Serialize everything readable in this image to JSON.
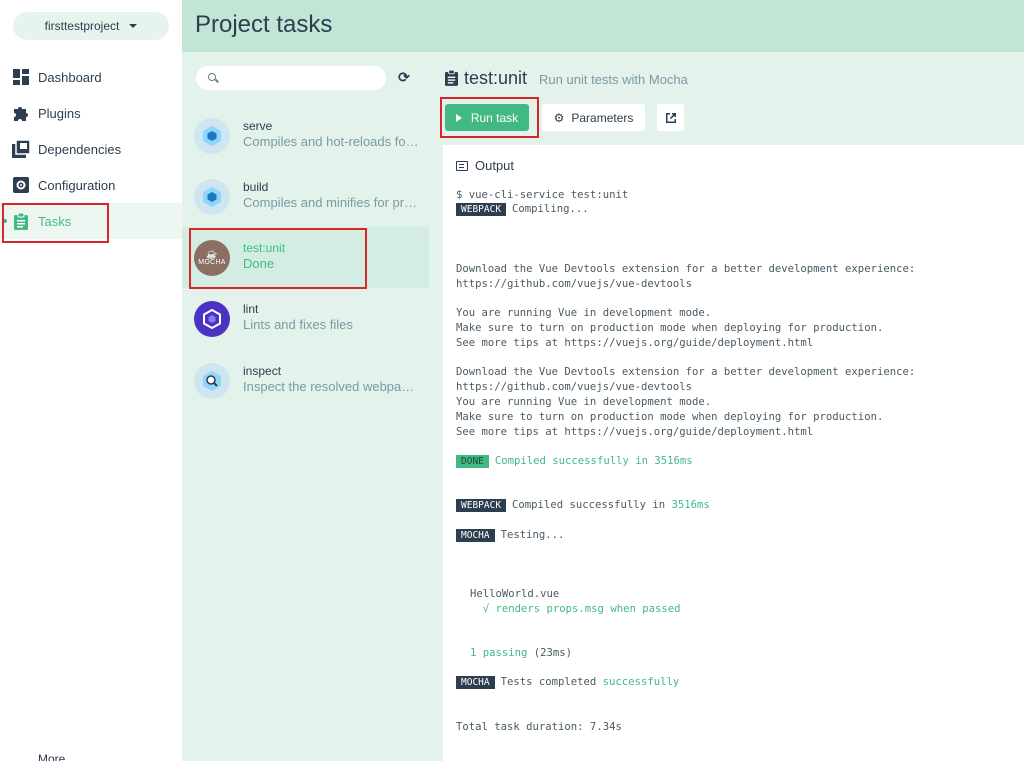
{
  "sidebar": {
    "project": "firsttestproject",
    "items": [
      {
        "label": "Dashboard"
      },
      {
        "label": "Plugins"
      },
      {
        "label": "Dependencies"
      },
      {
        "label": "Configuration"
      },
      {
        "label": "Tasks"
      }
    ],
    "more": "More"
  },
  "header": {
    "title": "Project tasks"
  },
  "search": {
    "placeholder": ""
  },
  "tasks": [
    {
      "name": "serve",
      "desc": "Compiles and hot-reloads for development"
    },
    {
      "name": "build",
      "desc": "Compiles and minifies for production"
    },
    {
      "name": "test:unit",
      "desc": "Done",
      "avatar_text": "MOCHA"
    },
    {
      "name": "lint",
      "desc": "Lints and fixes files"
    },
    {
      "name": "inspect",
      "desc": "Inspect the resolved webpack config"
    }
  ],
  "details": {
    "name": "test:unit",
    "desc": "Run unit tests with Mocha",
    "run_label": "Run task",
    "params_label": "Parameters",
    "output_label": "Output"
  },
  "log": {
    "l1": "$ vue-cli-service test:unit",
    "tag_webpack": "WEBPACK",
    "tag_done": "DONE",
    "tag_mocha": "MOCHA",
    "compiling": "Compiling...",
    "devtools1": "Download the Vue Devtools extension for a better development experience:",
    "devtools2": "https://github.com/vuejs/vue-devtools",
    "dev1": "You are running Vue in development mode.",
    "dev2": "Make sure to turn on production mode when deploying for production.",
    "dev3": "See more tips at https://vuejs.org/guide/deployment.html",
    "compiled_ok": "Compiled successfully in 3516ms",
    "compiled_prefix": "Compiled successfully in ",
    "compiled_time": "3516ms",
    "testing": "Testing...",
    "suite": "HelloWorld.vue",
    "test_case": "  √ renders props.msg when passed",
    "passing": "1 passing",
    "passing_time": " (23ms)",
    "tests_prefix": "Tests completed ",
    "tests_word": "successfully",
    "duration": "Total task duration: 7.34s"
  },
  "colors": {
    "accent": "#42b983",
    "header_bg": "#c2e6d6",
    "panel_bg": "#e3f3ec",
    "highlight_border": "#d9262c"
  }
}
